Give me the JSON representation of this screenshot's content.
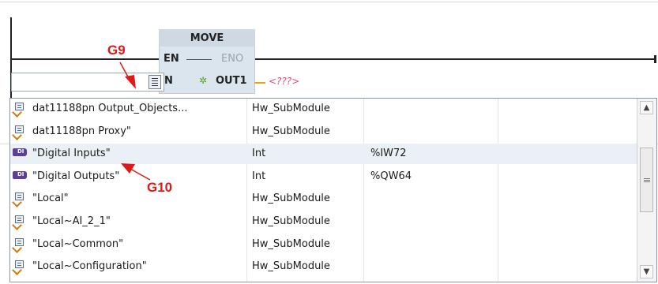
{
  "block": {
    "title": "MOVE",
    "pin_en": "EN",
    "pin_eno": "ENO",
    "pin_in": "N",
    "pin_out": "OUT1",
    "out_param": "<???>"
  },
  "input": {
    "value": ""
  },
  "annotations": {
    "g9": "G9",
    "g10": "G10",
    "color": "#e01818"
  },
  "colors": {
    "selected_row": "#eaf0f6",
    "tag_icon": "#5e3f93",
    "out_param": "#e0457b"
  },
  "rows": [
    {
      "icon": "submodule-icon",
      "name": "dat11188pn  Output_Objects...",
      "type": "Hw_SubModule",
      "address": ""
    },
    {
      "icon": "submodule-icon",
      "name": "dat11188pn  Proxy\"",
      "type": "Hw_SubModule",
      "address": ""
    },
    {
      "icon": "tag-icon",
      "name": "\"Digital Inputs\"",
      "type": "Int",
      "address": "%IW72"
    },
    {
      "icon": "tag-icon",
      "name": "\"Digital Outputs\"",
      "type": "Int",
      "address": "%QW64"
    },
    {
      "icon": "submodule-icon",
      "name": "\"Local\"",
      "type": "Hw_SubModule",
      "address": ""
    },
    {
      "icon": "submodule-icon",
      "name": "\"Local~AI_2_1\"",
      "type": "Hw_SubModule",
      "address": ""
    },
    {
      "icon": "submodule-icon",
      "name": "\"Local~Common\"",
      "type": "Hw_SubModule",
      "address": ""
    },
    {
      "icon": "submodule-icon",
      "name": "\"Local~Configuration\"",
      "type": "Hw_SubModule",
      "address": ""
    }
  ]
}
